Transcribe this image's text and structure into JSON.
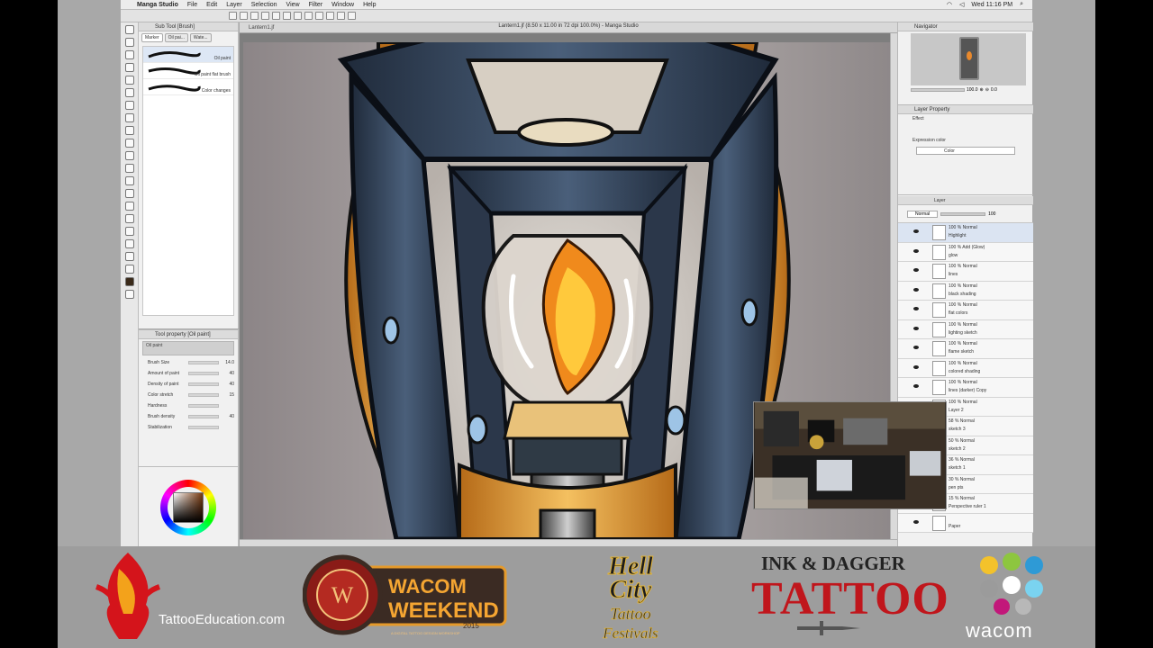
{
  "menubar": {
    "app": "Manga Studio",
    "items": [
      "File",
      "Edit",
      "Layer",
      "Selection",
      "View",
      "Filter",
      "Window",
      "Help"
    ],
    "clock": "Wed 11:16 PM"
  },
  "window": {
    "doc_tab": "Lantern1.jf",
    "doc_title": "Lantern1.jf (8.50 x 11.00 in 72 dpi 100.0%) - Manga Studio"
  },
  "subtool": {
    "title": "Sub Tool [Brush]",
    "tabs": [
      "Marker",
      "Oil pai...",
      "Wate..."
    ],
    "brushes": [
      {
        "label": "Oil paint"
      },
      {
        "label": "Oil paint flat brush"
      },
      {
        "label": "Color changes"
      }
    ]
  },
  "tool_property": {
    "title": "Tool property [Oil paint]",
    "preset": "Oil paint",
    "rows": [
      {
        "label": "Brush Size",
        "value": "14.0"
      },
      {
        "label": "Amount of paint",
        "value": "40"
      },
      {
        "label": "Density of paint",
        "value": "40"
      },
      {
        "label": "Color stretch",
        "value": "15"
      },
      {
        "label": "Hardness",
        "value": ""
      },
      {
        "label": "Brush density",
        "value": "40"
      },
      {
        "label": "Stabilization",
        "value": ""
      }
    ]
  },
  "navigator": {
    "title": "Navigator",
    "zoom": "100.0",
    "rotate": "0.0"
  },
  "layer_property": {
    "title": "Layer Property",
    "subtitle": "Effect",
    "expression_color_label": "Expression color",
    "expression_color_value": "Color"
  },
  "layers": {
    "title": "Layer",
    "blend_mode": "Normal",
    "opacity": "100",
    "items": [
      {
        "mode": "100 % Normal",
        "name": "Highlight",
        "selected": true
      },
      {
        "mode": "100 % Add (Glow)",
        "name": "glow",
        "selected": false
      },
      {
        "mode": "100 % Normal",
        "name": "lines",
        "selected": false
      },
      {
        "mode": "100 % Normal",
        "name": "black shading",
        "selected": false
      },
      {
        "mode": "100 % Normal",
        "name": "flat colors",
        "selected": false
      },
      {
        "mode": "100 % Normal",
        "name": "lighting sketch",
        "selected": false
      },
      {
        "mode": "100 % Normal",
        "name": "flame sketch",
        "selected": false
      },
      {
        "mode": "100 % Normal",
        "name": "colored shading",
        "selected": false
      },
      {
        "mode": "100 % Normal",
        "name": "lines (darker) Copy",
        "selected": false
      },
      {
        "mode": "100 % Normal",
        "name": "Layer 2",
        "selected": false
      },
      {
        "mode": "58 % Normal",
        "name": "sketch 3",
        "selected": false
      },
      {
        "mode": "50 % Normal",
        "name": "sketch 2",
        "selected": false
      },
      {
        "mode": "36 % Normal",
        "name": "sketch 1",
        "selected": false
      },
      {
        "mode": "30 % Normal",
        "name": "pen pts",
        "selected": false
      },
      {
        "mode": "15 % Normal",
        "name": "Perspective ruler 1",
        "selected": false
      },
      {
        "mode": "",
        "name": "Paper",
        "selected": false
      }
    ]
  },
  "sponsors": {
    "tattoo_education": "TattooEducation.com",
    "wacom_weekend_top": "WACOM",
    "wacom_weekend_bottom": "WEEKEND",
    "wacom_weekend_year": "2015",
    "wacom_weekend_tag": "A DIGITAL TATTOO DESIGN WORKSHOP",
    "hell_city_1": "Hell",
    "hell_city_2": "City",
    "hell_city_3": "Tattoo",
    "hell_city_4": "Festivals",
    "ink_dagger_top": "INK & DAGGER",
    "ink_dagger_bottom": "TATTOO",
    "wacom": "wacom"
  },
  "colors": {
    "banner_bg": "#9d9d9d",
    "tattoo_red": "#c0161c",
    "lantern_metal": "#2e3b4f",
    "lantern_gold": "#e8a73a",
    "flame_orange": "#f08a1c"
  }
}
